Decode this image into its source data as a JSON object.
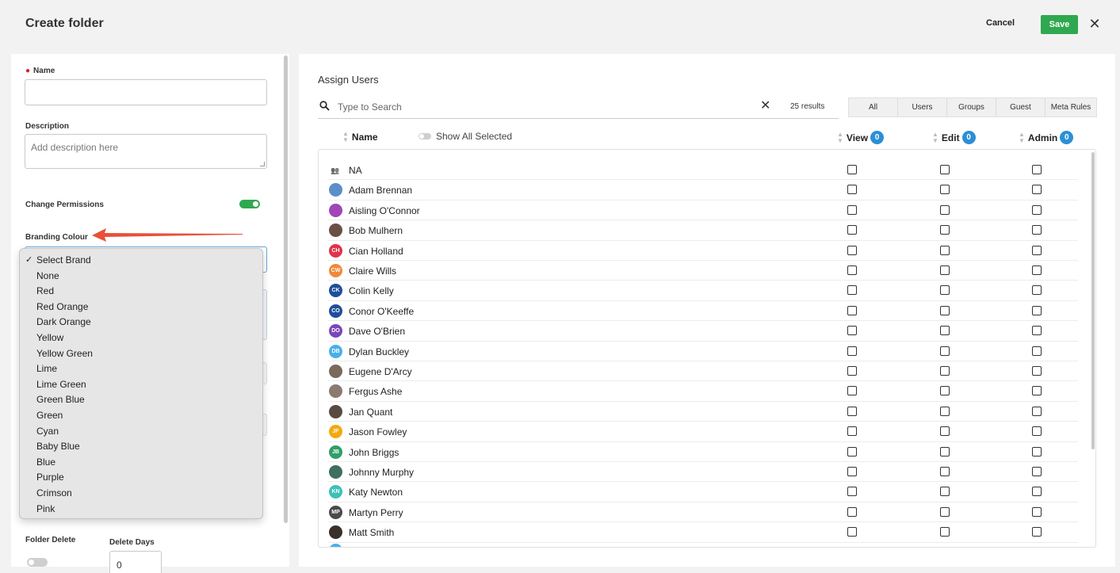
{
  "header": {
    "title": "Create folder",
    "cancel_label": "Cancel",
    "save_label": "Save",
    "close_icon": "close-icon"
  },
  "form": {
    "name_label": "Name",
    "name_value": "",
    "description_label": "Description",
    "description_placeholder": "Add description here",
    "change_permissions_label": "Change Permissions",
    "change_permissions_on": true,
    "branding_colour_label": "Branding Colour",
    "brand_options": [
      "Select Brand",
      "None",
      "Red",
      "Red Orange",
      "Dark Orange",
      "Yellow",
      "Yellow Green",
      "Lime",
      "Lime Green",
      "Green Blue",
      "Green",
      "Cyan",
      "Baby Blue",
      "Blue",
      "Purple",
      "Crimson",
      "Pink"
    ],
    "brand_selected": "Select Brand",
    "folder_delete_label": "Folder Delete",
    "folder_delete_on": false,
    "delete_days_label": "Delete Days",
    "delete_days_value": "0"
  },
  "assign": {
    "title": "Assign Users",
    "search_placeholder": "Type to Search",
    "results": "25 results",
    "filters": [
      "All",
      "Users",
      "Groups",
      "Guest",
      "Meta Rules"
    ],
    "columns": {
      "name": "Name",
      "show_all_selected": "Show All Selected",
      "view": "View",
      "view_count": "0",
      "edit": "Edit",
      "edit_count": "0",
      "admin": "Admin",
      "admin_count": "0"
    },
    "rows": [
      {
        "name": "NA",
        "type": "group",
        "initials": "",
        "color": "#333333"
      },
      {
        "name": "Adam Brennan",
        "type": "photo",
        "initials": "",
        "color": "#5b8fc7"
      },
      {
        "name": "Aisling O'Connor",
        "type": "photo",
        "initials": "",
        "color": "#a046b8"
      },
      {
        "name": "Bob Mulhern",
        "type": "photo",
        "initials": "",
        "color": "#6b4f45"
      },
      {
        "name": "Cian Holland",
        "type": "initials",
        "initials": "CH",
        "color": "#e0334a"
      },
      {
        "name": "Claire Wills",
        "type": "initials",
        "initials": "CW",
        "color": "#ef8a3c"
      },
      {
        "name": "Colin Kelly",
        "type": "initials",
        "initials": "CK",
        "color": "#1f4e9c"
      },
      {
        "name": "Conor O'Keeffe",
        "type": "initials",
        "initials": "CO",
        "color": "#1f4e9c"
      },
      {
        "name": "Dave O'Brien",
        "type": "initials",
        "initials": "DO",
        "color": "#7b47b8"
      },
      {
        "name": "Dylan Buckley",
        "type": "initials",
        "initials": "DB",
        "color": "#4ab0e8"
      },
      {
        "name": "Eugene D'Arcy",
        "type": "photo",
        "initials": "",
        "color": "#7a6a5c"
      },
      {
        "name": "Fergus Ashe",
        "type": "photo",
        "initials": "",
        "color": "#8a7a70"
      },
      {
        "name": "Jan Quant",
        "type": "photo",
        "initials": "",
        "color": "#5a4a40"
      },
      {
        "name": "Jason Fowley",
        "type": "initials",
        "initials": "JF",
        "color": "#f2a90f"
      },
      {
        "name": "John Briggs",
        "type": "initials",
        "initials": "JB",
        "color": "#2f9e6a"
      },
      {
        "name": "Johnny Murphy",
        "type": "photo",
        "initials": "",
        "color": "#3e6f60"
      },
      {
        "name": "Katy Newton",
        "type": "initials",
        "initials": "KN",
        "color": "#3cc0b8"
      },
      {
        "name": "Martyn Perry",
        "type": "initials",
        "initials": "MP",
        "color": "#4a4a4a"
      },
      {
        "name": "Matt Smith",
        "type": "photo",
        "initials": "",
        "color": "#3a2f2a"
      }
    ]
  },
  "colors": {
    "accent_green": "#2fa84f",
    "badge_blue": "#2b8fd6",
    "required_red": "#d42020",
    "annotation_arrow": "#e8503a"
  }
}
